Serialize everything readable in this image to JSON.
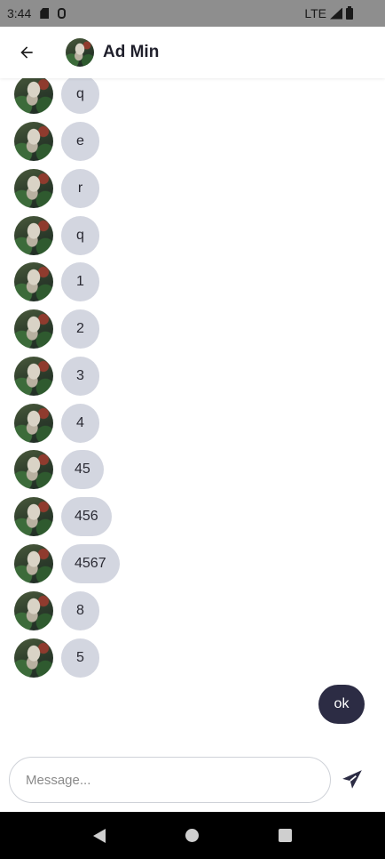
{
  "status_bar": {
    "time": "3:44",
    "network": "LTE"
  },
  "header": {
    "title": "Ad Min"
  },
  "messages": {
    "incoming": [
      "q",
      "e",
      "r",
      "q",
      "1",
      "2",
      "3",
      "4",
      "45",
      "456",
      "4567",
      "8",
      "5"
    ],
    "outgoing": [
      "ok"
    ]
  },
  "composer": {
    "placeholder": "Message..."
  },
  "icons": {
    "back": "arrow-left-icon",
    "send": "paper-plane-icon",
    "nav": [
      "nav-back-icon",
      "nav-home-icon",
      "nav-recents-icon"
    ]
  },
  "colors": {
    "incoming_bubble": "#d3d6e0",
    "outgoing_bubble": "#2c2c44",
    "status_bar": "#8e8e8e",
    "nav_bar": "#000000"
  }
}
